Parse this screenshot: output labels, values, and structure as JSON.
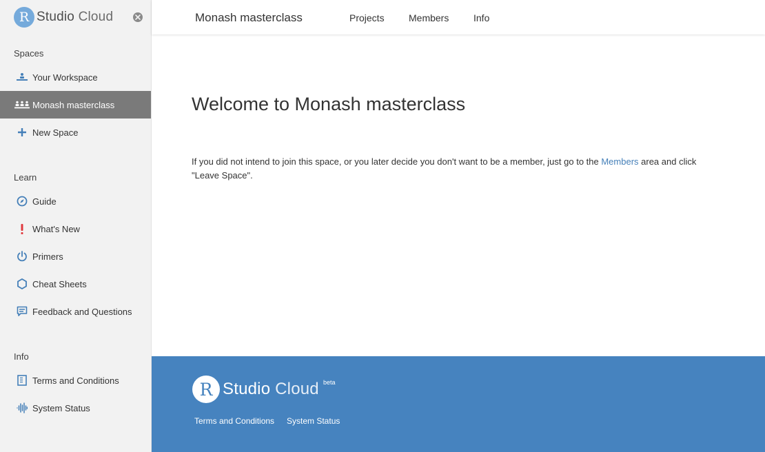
{
  "app": {
    "logo_r": "R",
    "logo_word1": "Studio",
    "logo_word2": "Cloud"
  },
  "sidebar": {
    "spaces_heading": "Spaces",
    "spaces": [
      {
        "label": "Your Workspace",
        "icon": "workspace-icon"
      },
      {
        "label": "Monash masterclass",
        "icon": "people-icon",
        "active": true
      },
      {
        "label": "New Space",
        "icon": "plus-icon"
      }
    ],
    "learn_heading": "Learn",
    "learn": [
      {
        "label": "Guide",
        "icon": "compass-icon"
      },
      {
        "label": "What's New",
        "icon": "exclamation-icon"
      },
      {
        "label": "Primers",
        "icon": "power-icon"
      },
      {
        "label": "Cheat Sheets",
        "icon": "hexagon-icon"
      },
      {
        "label": "Feedback and Questions",
        "icon": "chat-icon"
      }
    ],
    "info_heading": "Info",
    "info": [
      {
        "label": "Terms and Conditions",
        "icon": "document-icon"
      },
      {
        "label": "System Status",
        "icon": "pulse-icon"
      }
    ]
  },
  "header": {
    "space_title": "Monash masterclass",
    "tabs": [
      {
        "label": "Projects"
      },
      {
        "label": "Members"
      },
      {
        "label": "Info"
      }
    ]
  },
  "main": {
    "title": "Welcome to Monash masterclass",
    "text_before": "If you did not intend to join this space, or you later decide you don't want to be a member, just go to the ",
    "link": "Members",
    "text_after": " area and click \"Leave Space\"."
  },
  "footer": {
    "beta": "beta",
    "links": [
      {
        "label": "Terms and Conditions"
      },
      {
        "label": "System Status"
      }
    ]
  },
  "colors": {
    "brand_blue": "#75aadb",
    "footer_blue": "#4683bf",
    "link_blue": "#447fb8",
    "active_item": "#7a7a7a",
    "alert_red": "#e0393e"
  }
}
